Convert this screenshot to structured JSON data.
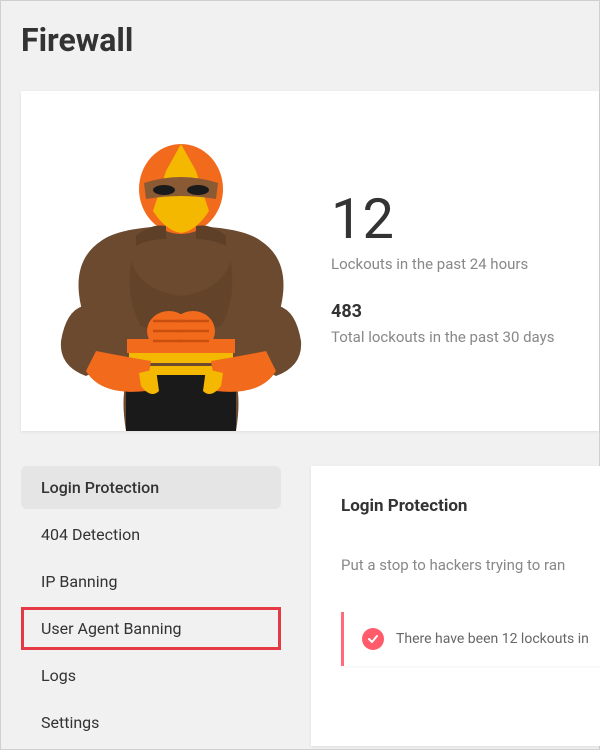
{
  "page": {
    "title": "Firewall"
  },
  "summary": {
    "big_number": "12",
    "big_label": "Lockouts in the past 24 hours",
    "sub_number": "483",
    "sub_label": "Total lockouts in the past 30 days"
  },
  "tabs": {
    "items": [
      {
        "label": "Login Protection"
      },
      {
        "label": "404 Detection"
      },
      {
        "label": "IP Banning"
      },
      {
        "label": "User Agent Banning"
      },
      {
        "label": "Logs"
      },
      {
        "label": "Settings"
      }
    ]
  },
  "panel": {
    "title": "Login Protection",
    "description": "Put a stop to hackers trying to ran",
    "alert_text": "There have been 12 lockouts in"
  }
}
